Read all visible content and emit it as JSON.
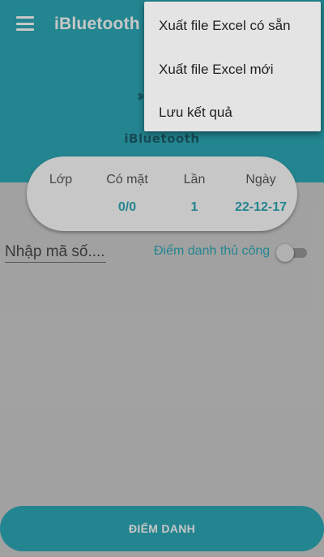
{
  "app": {
    "title": "iBluetooth",
    "logo_text": "iBluetooth"
  },
  "info_card": {
    "columns": [
      {
        "label": "Lớp",
        "value": ""
      },
      {
        "label": "Có mặt",
        "value": "0/0"
      },
      {
        "label": "Lần",
        "value": "1"
      },
      {
        "label": "Ngày",
        "value": "22-12-17"
      }
    ]
  },
  "form": {
    "code_placeholder": "Nhập mã số....",
    "manual_label": "Điểm danh thủ công",
    "manual_enabled": false
  },
  "primary_button": {
    "label": "ĐIỂM DANH"
  },
  "menu": {
    "items": [
      {
        "label": "Xuất file Excel có sẵn"
      },
      {
        "label": "Xuất file Excel mới"
      },
      {
        "label": "Lưu kết quả"
      }
    ]
  },
  "colors": {
    "accent": "#2eabb9",
    "background": "#cfcfcf",
    "menu_background": "#e4e4e4"
  },
  "icons": {
    "menu": "hamburger-menu-icon",
    "logo": "bluetooth-logo-icon"
  }
}
